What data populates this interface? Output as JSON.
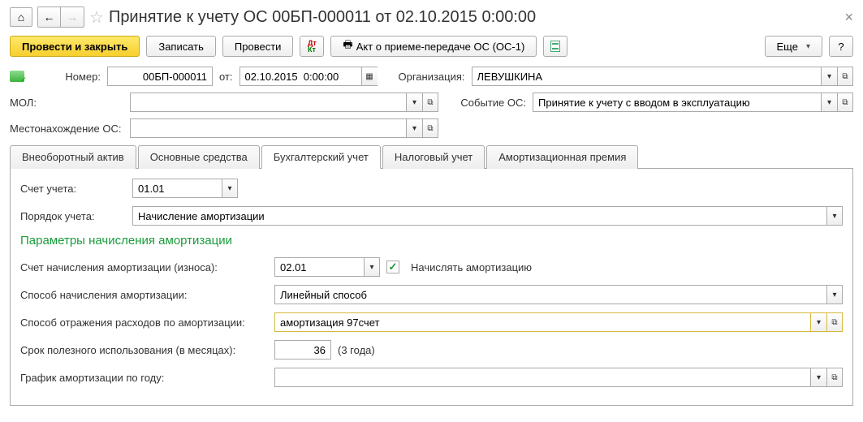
{
  "title": "Принятие к учету ОС 00БП-000011 от 02.10.2015 0:00:00",
  "toolbar": {
    "post_close": "Провести и закрыть",
    "write": "Записать",
    "post": "Провести",
    "print_act": "Акт о приеме-передаче ОС (ОС-1)",
    "more": "Еще",
    "help": "?"
  },
  "header": {
    "number_lbl": "Номер:",
    "number": "00БП-000011",
    "from_lbl": "от:",
    "date": "02.10.2015  0:00:00",
    "org_lbl": "Организация:",
    "org": "ЛЕВУШКИНА",
    "mol_lbl": "МОЛ:",
    "mol": "",
    "event_lbl": "Событие ОС:",
    "event": "Принятие к учету с вводом в эксплуатацию",
    "loc_lbl": "Местонахождение ОС:",
    "loc": ""
  },
  "tabs": [
    "Внеоборотный актив",
    "Основные средства",
    "Бухгалтерский учет",
    "Налоговый учет",
    "Амортизационная премия"
  ],
  "active_tab": 2,
  "panel": {
    "acct_lbl": "Счет учета:",
    "acct": "01.01",
    "order_lbl": "Порядок учета:",
    "order": "Начисление амортизации",
    "section": "Параметры начисления амортизации",
    "dep_acct_lbl": "Счет начисления амортизации (износа):",
    "dep_acct": "02.01",
    "dep_chk_lbl": "Начислять амортизацию",
    "method_lbl": "Способ начисления амортизации:",
    "method": "Линейный способ",
    "expense_lbl": "Способ отражения расходов по амортизации:",
    "expense": "амортизация 97счет",
    "life_lbl": "Срок полезного использования (в месяцах):",
    "life": "36",
    "life_hint": "(3 года)",
    "sched_lbl": "График амортизации по году:",
    "sched": ""
  }
}
